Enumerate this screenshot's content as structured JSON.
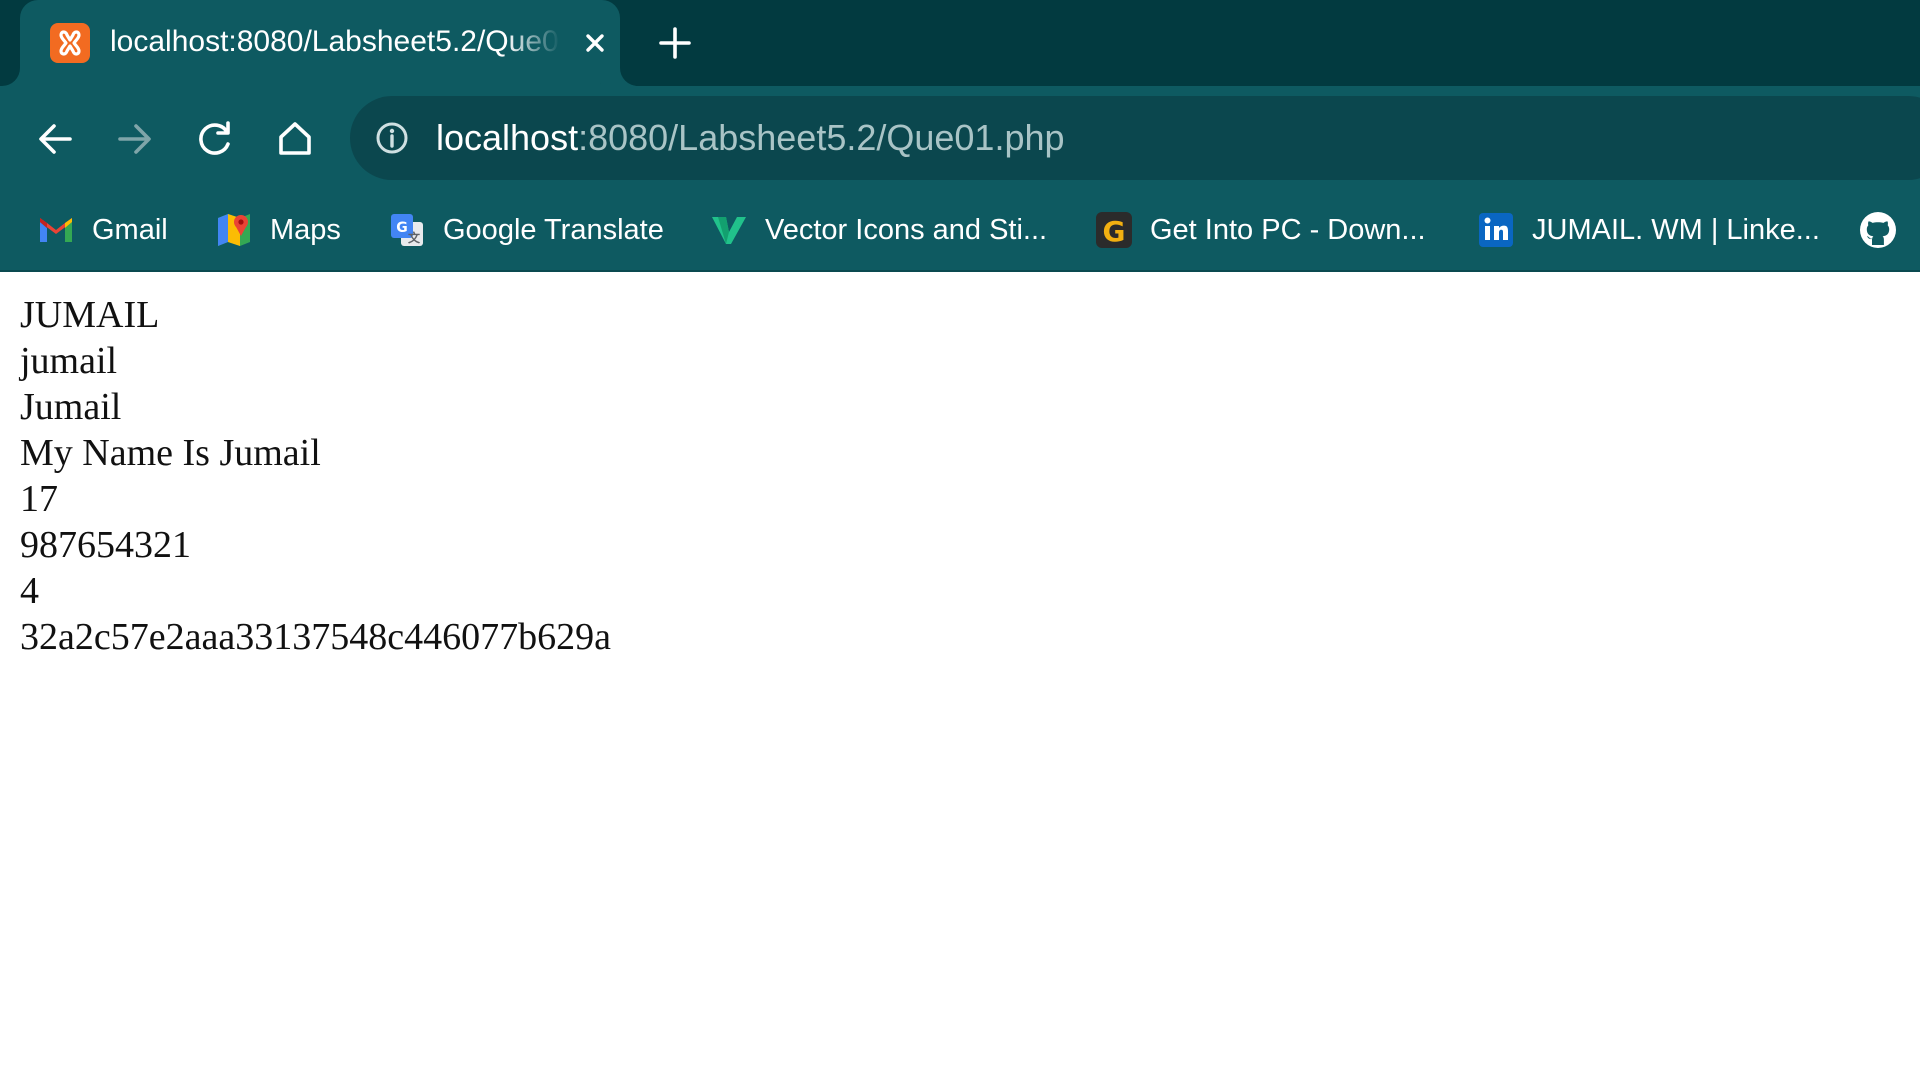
{
  "tab": {
    "title": "localhost:8080/Labsheet5.2/Que01.php",
    "favicon": "xampp-icon"
  },
  "toolbar": {
    "url_host": "localhost",
    "url_rest": ":8080/Labsheet5.2/Que01.php"
  },
  "bookmarks": [
    {
      "label": "Gmail",
      "icon": "gmail-icon"
    },
    {
      "label": "Maps",
      "icon": "maps-icon"
    },
    {
      "label": "Google Translate",
      "icon": "google-translate-icon"
    },
    {
      "label": "Vector Icons and Sti...",
      "icon": "vector-icons-icon"
    },
    {
      "label": "Get Into PC - Down...",
      "icon": "get-into-pc-icon"
    },
    {
      "label": "JUMAIL. WM | Linke...",
      "icon": "linkedin-icon"
    },
    {
      "label": "",
      "icon": "github-icon"
    }
  ],
  "page": {
    "lines": [
      "JUMAIL",
      "jumail",
      "Jumail",
      "My Name Is Jumail",
      "17",
      "987654321",
      "4",
      "32a2c57e2aaa33137548c446077b629a"
    ]
  },
  "colors": {
    "tab_strip": "#023a40",
    "toolbar": "#0e5a61",
    "omnibox": "#0b474e",
    "page_background": "#ffffff",
    "text": "#111111"
  }
}
